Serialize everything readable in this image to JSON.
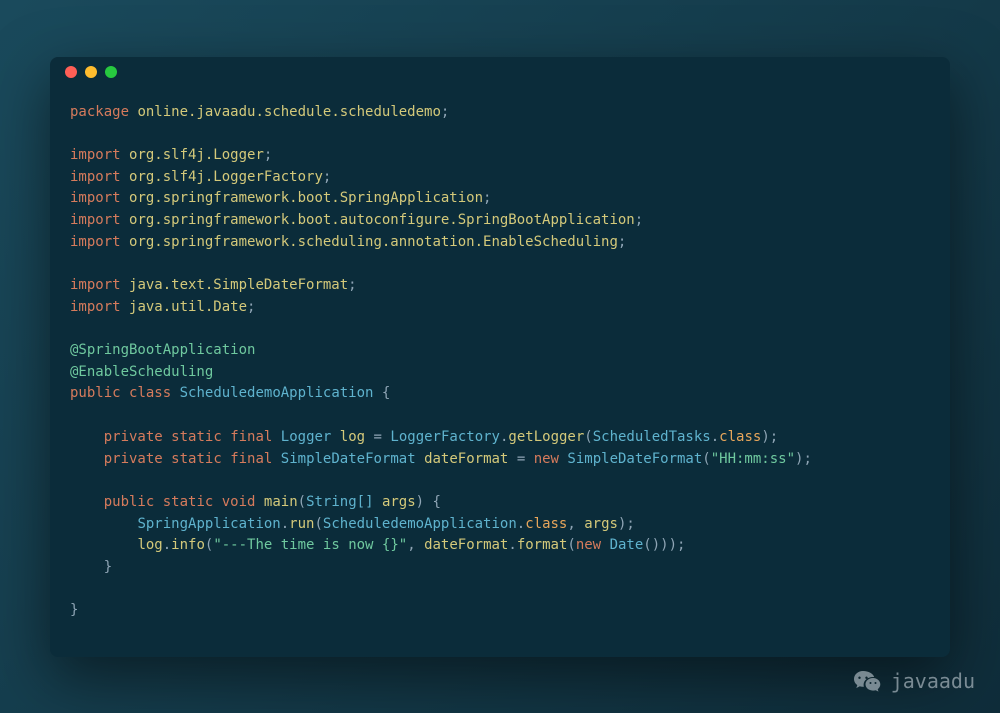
{
  "window": {
    "buttons": [
      "close",
      "minimize",
      "maximize"
    ]
  },
  "code": {
    "package_kw": "package",
    "package_name": "online.javaadu.schedule.scheduledemo",
    "import_kw": "import",
    "imports": [
      "org.slf4j.Logger",
      "org.slf4j.LoggerFactory",
      "org.springframework.boot.SpringApplication",
      "org.springframework.boot.autoconfigure.SpringBootApplication",
      "org.springframework.scheduling.annotation.EnableScheduling"
    ],
    "java_imports": [
      "java.text.SimpleDateFormat",
      "java.util.Date"
    ],
    "annotation1": "@SpringBootApplication",
    "annotation2": "@EnableScheduling",
    "public_kw": "public",
    "class_kw": "class",
    "class_name": "ScheduledemoApplication",
    "private_kw": "private",
    "static_kw": "static",
    "final_kw": "final",
    "void_kw": "void",
    "new_kw": "new",
    "logger_type": "Logger",
    "log_var": "log",
    "logger_factory": "LoggerFactory",
    "getlogger": "getLogger",
    "scheduled_tasks": "ScheduledTasks",
    "class_suffix": "class",
    "sdf_type": "SimpleDateFormat",
    "dateformat_var": "dateFormat",
    "sdf_pattern": "\"HH:mm:ss\"",
    "main_method": "main",
    "string_arr": "String[]",
    "args_param": "args",
    "spring_app": "SpringApplication",
    "run_method": "run",
    "sched_app": "ScheduledemoApplication",
    "log_info": "info",
    "log_msg": "\"---The time is now {}\"",
    "format_method": "format",
    "date_type": "Date"
  },
  "watermark": {
    "text": "javaadu"
  }
}
